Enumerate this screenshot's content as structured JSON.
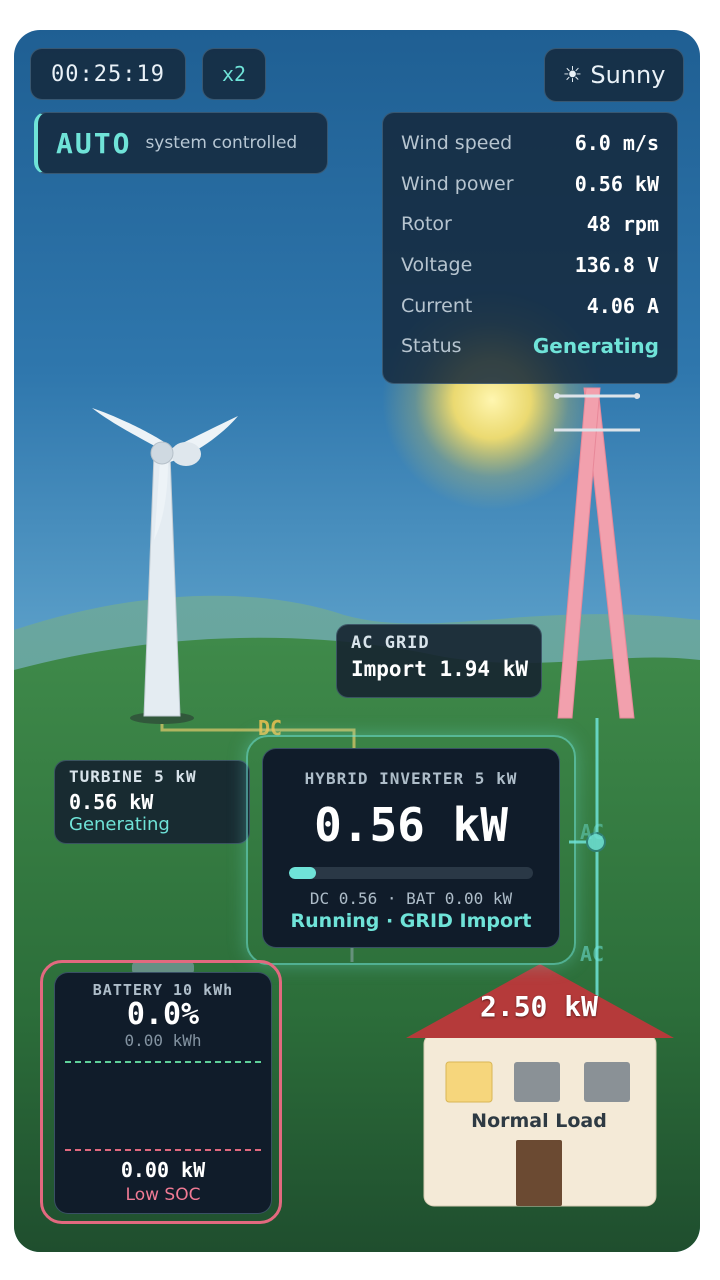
{
  "clock": "00:25:19",
  "speed": "x2",
  "weather": {
    "icon": "sun-icon",
    "glyph": "☀",
    "label": "Sunny"
  },
  "mode": {
    "label": "AUTO",
    "sub": "system controlled"
  },
  "stats": {
    "rows": [
      {
        "label": "Wind speed",
        "value": "6.0 m/s"
      },
      {
        "label": "Wind power",
        "value": "0.56 kW"
      },
      {
        "label": "Rotor",
        "value": "48 rpm"
      },
      {
        "label": "Voltage",
        "value": "136.8 V"
      },
      {
        "label": "Current",
        "value": "4.06 A"
      },
      {
        "label": "Status",
        "value": "Generating"
      }
    ]
  },
  "grid": {
    "title": "AC GRID",
    "value": "Import 1.94 kW"
  },
  "turbine": {
    "title": "TURBINE 5 kW",
    "value": "0.56 kW",
    "status": "Generating"
  },
  "inverter": {
    "title": "HYBRID INVERTER 5 kW",
    "power": "0.56 kW",
    "load_fraction": 0.11,
    "detail": "DC 0.56 · BAT 0.00 kW",
    "status": "Running · GRID Import"
  },
  "battery": {
    "title": "BATTERY 10 kWh",
    "soc": "0.0%",
    "energy": "0.00 kWh",
    "power": "0.00 kW",
    "status": "Low SOC"
  },
  "house": {
    "power": "2.50 kW",
    "label": "Normal Load"
  },
  "flows": {
    "dc": "DC",
    "ac_top": "AC",
    "ac_bottom": "AC"
  },
  "colors": {
    "accent": "#6fe3d8",
    "dc": "#f1c24f",
    "warning": "#e2697f",
    "roof": "#b53a3a"
  }
}
